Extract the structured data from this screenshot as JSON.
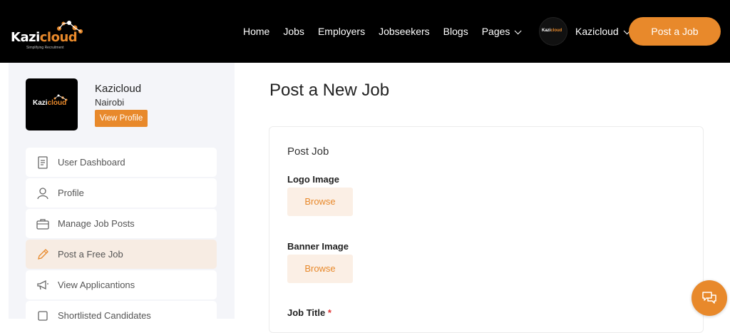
{
  "brand": {
    "logo_main": "Kazi",
    "logo_accent": "cloud",
    "tagline": "Simplifying Recruitment",
    "accent_color": "#e8892b"
  },
  "nav": {
    "items": [
      "Home",
      "Jobs",
      "Employers",
      "Jobseekers",
      "Blogs",
      "Pages"
    ],
    "user_name": "Kazicloud",
    "post_job_label": "Post a Job"
  },
  "profile": {
    "name": "Kazicloud",
    "location": "Nairobi",
    "view_profile_label": "View Profile"
  },
  "sidebar": {
    "items": [
      {
        "label": "User Dashboard",
        "icon": "document-icon"
      },
      {
        "label": "Profile",
        "icon": "user-icon"
      },
      {
        "label": "Manage Job Posts",
        "icon": "briefcase-icon"
      },
      {
        "label": "Post a Free Job",
        "icon": "pencil-icon",
        "active": true
      },
      {
        "label": "View Applicantions",
        "icon": "megaphone-icon"
      },
      {
        "label": "Shortlisted Candidates",
        "icon": "checkbox-icon"
      }
    ]
  },
  "main": {
    "title": "Post a New Job",
    "card_title": "Post Job",
    "fields": {
      "logo_label": "Logo Image",
      "banner_label": "Banner Image",
      "job_title_label": "Job Title",
      "required_mark": "*",
      "browse_label": "Browse"
    }
  }
}
